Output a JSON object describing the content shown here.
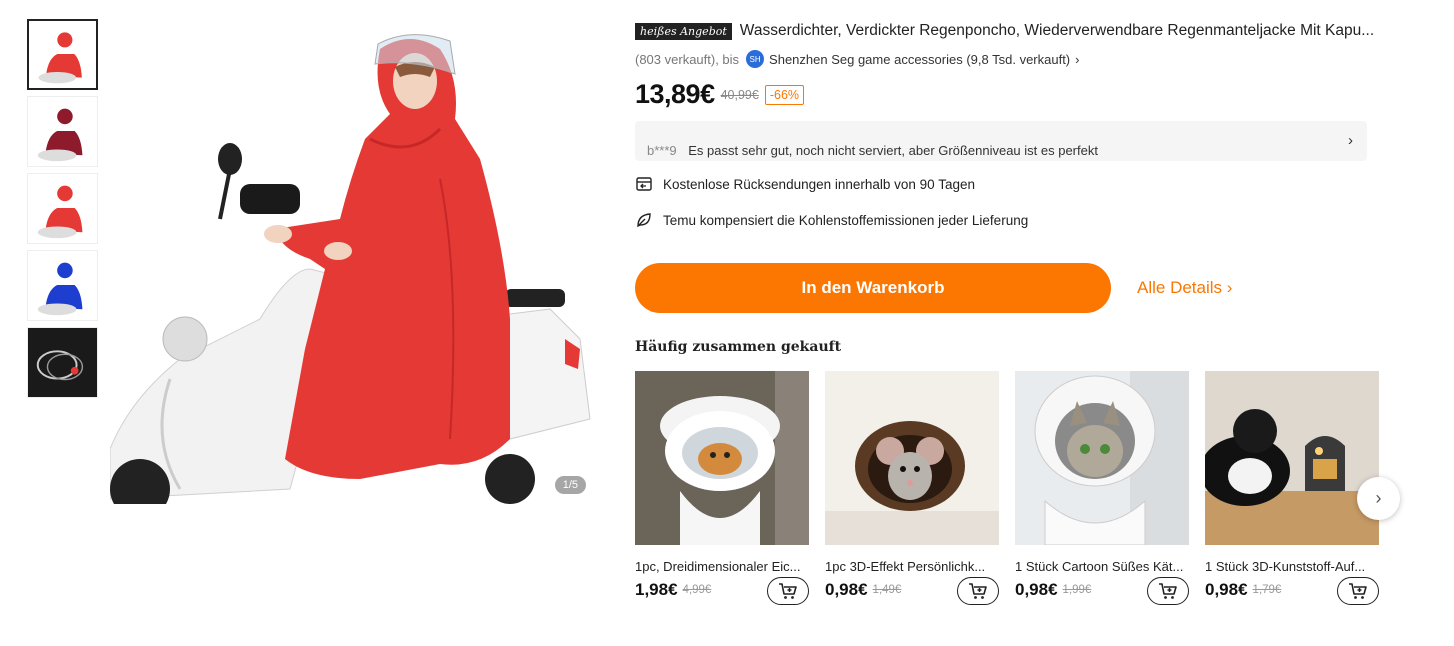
{
  "gallery": {
    "counter": "1/5",
    "thumbnails": [
      {
        "color": "#e53935"
      },
      {
        "color": "#8e1b2b"
      },
      {
        "color": "#e53935"
      },
      {
        "color": "#1e3ecf"
      },
      {
        "color": "#444444"
      }
    ]
  },
  "product": {
    "badge": "heißes Angebot",
    "title": "Wasserdichter, Verdickter Regenponcho, Wiederverwendbare Regenmanteljacke Mit Kapu...",
    "sold_text": "(803 verkauft), bis",
    "store_avatar": "SH",
    "store_name": "Shenzhen Seg game accessories (9,8 Tsd. verkauft)",
    "price": "13,89€",
    "old_price": "40,99€",
    "discount": "-66%"
  },
  "review": {
    "user": "b***9",
    "text": "Es passt sehr gut, noch nicht serviert, aber Größenniveau ist es perfekt"
  },
  "features": [
    {
      "icon": "return-box-icon",
      "text": "Kostenlose Rücksendungen innerhalb von 90 Tagen"
    },
    {
      "icon": "leaf-icon",
      "text": "Temu kompensiert die Kohlenstoffemissionen jeder Lieferung"
    }
  ],
  "actions": {
    "cart_label": "In den Warenkorb",
    "details_label": "Alle Details"
  },
  "fbt": {
    "title": "Häufig zusammen gekauft",
    "items": [
      {
        "name": "1pc, Dreidimensionaler Eic...",
        "price": "1,98€",
        "old_price": "4,99€"
      },
      {
        "name": "1pc 3D-Effekt Persönlichk...",
        "price": "0,98€",
        "old_price": "1,49€"
      },
      {
        "name": "1 Stück Cartoon Süßes Kät...",
        "price": "0,98€",
        "old_price": "1,99€"
      },
      {
        "name": "1 Stück 3D-Kunststoff-Auf...",
        "price": "0,98€",
        "old_price": "1,79€"
      }
    ]
  },
  "colors": {
    "accent": "#fb7701",
    "raincoat": "#e53935"
  }
}
